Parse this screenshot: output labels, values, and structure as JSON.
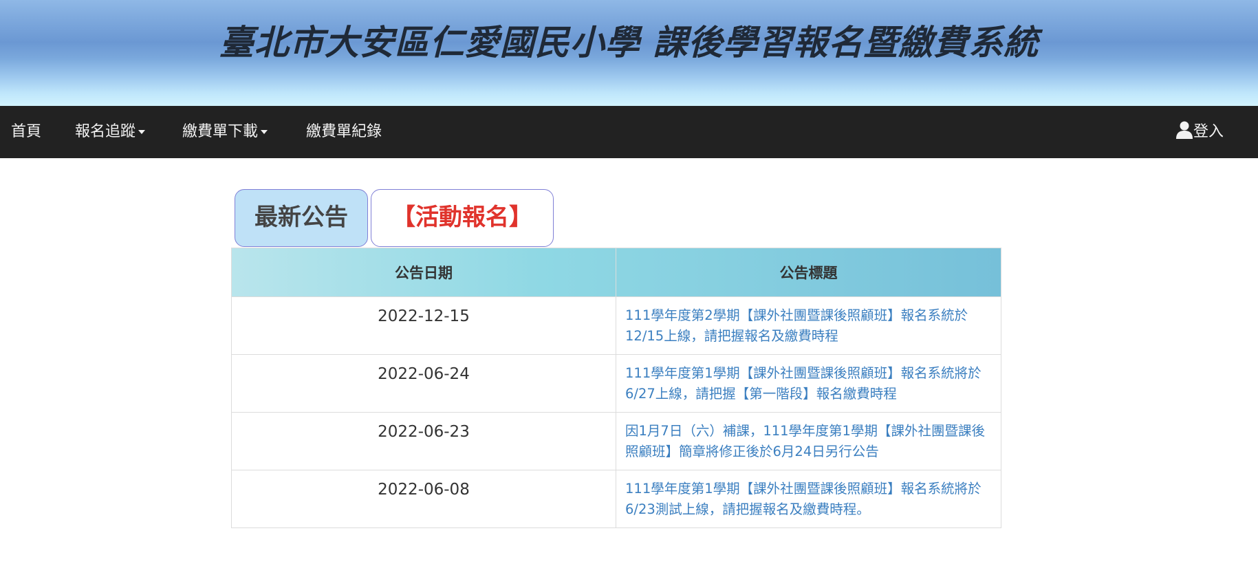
{
  "header": {
    "title": "臺北市大安區仁愛國民小學 課後學習報名暨繳費系統"
  },
  "nav": {
    "home": "首頁",
    "tracking": "報名追蹤",
    "bill_download": "繳費單下載",
    "bill_records": "繳費單紀錄",
    "login": "登入"
  },
  "tabs": {
    "news": "最新公告",
    "activity": "【活動報名】"
  },
  "table": {
    "headers": {
      "date": "公告日期",
      "title": "公告標題"
    },
    "rows": [
      {
        "date": "2022-12-15",
        "title": "111學年度第2學期【課外社團暨課後照顧班】報名系統於12/15上線，請把握報名及繳費時程"
      },
      {
        "date": "2022-06-24",
        "title": "111學年度第1學期【課外社團暨課後照顧班】報名系統將於6/27上線，請把握【第一階段】報名繳費時程"
      },
      {
        "date": "2022-06-23",
        "title": "因1月7日（六）補課，111學年度第1學期【課外社團暨課後照顧班】簡章將修正後於6月24日另行公告"
      },
      {
        "date": "2022-06-08",
        "title": "111學年度第1學期【課外社團暨課後照顧班】報名系統將於6/23測試上線，請把握報名及繳費時程。"
      }
    ]
  },
  "colors": {
    "navbar": "#222222",
    "link": "#3b7fc0",
    "activity_tab_text": "#e0332c",
    "news_tab_bg": "#bfe1f7"
  },
  "icons": {
    "login": "user-icon",
    "dropdown": "caret-down-icon"
  }
}
